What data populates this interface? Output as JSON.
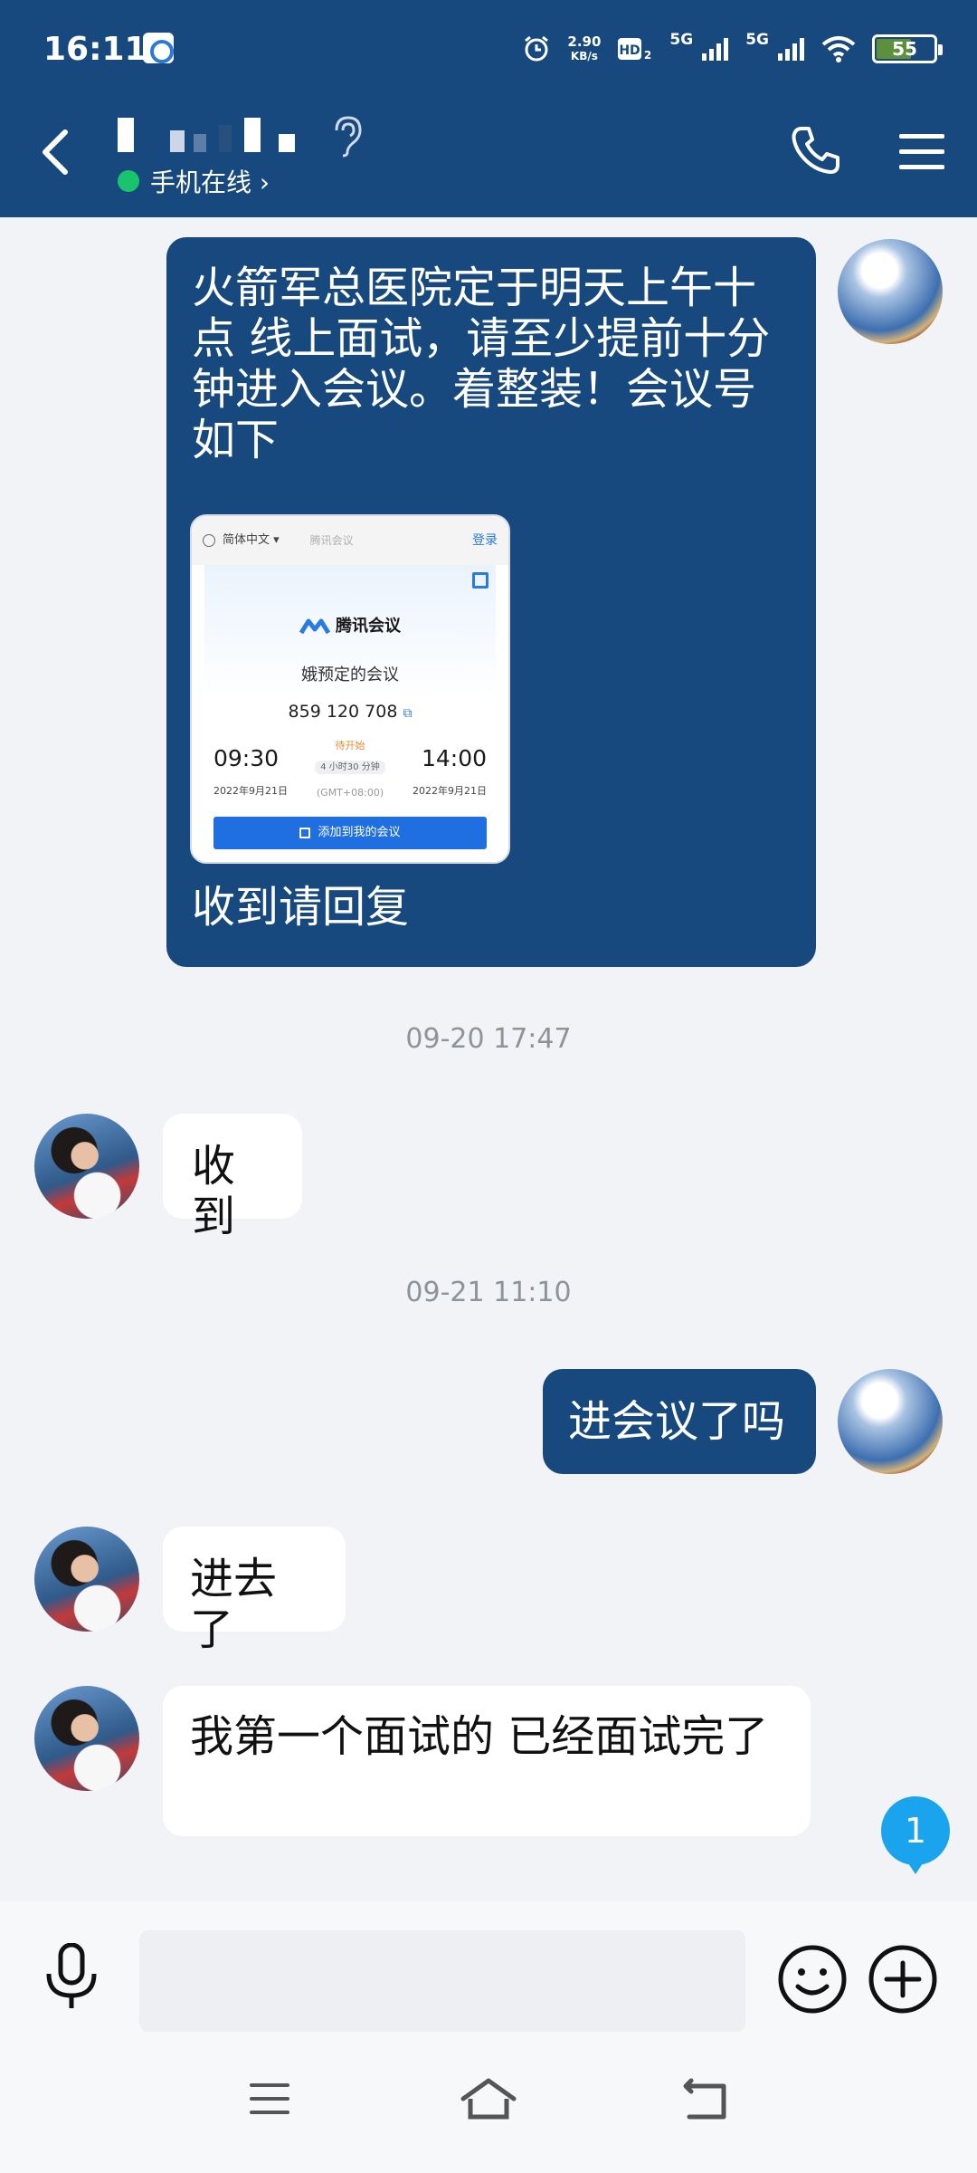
{
  "status_bar": {
    "time": "16:11",
    "net_speed_value": "2.90",
    "net_speed_unit": "KB/s",
    "hd_label": "HD",
    "hd_sub": "2",
    "signal1_label": "5G",
    "signal2_label": "5G",
    "battery_level": "55",
    "battery_color": "#5e8f3c"
  },
  "header": {
    "background": "#17497f",
    "presence_text": "手机在线 ›",
    "presence_color": "#19c46d",
    "icons": [
      "back-arrow-icon",
      "ear-icon",
      "phone-icon",
      "menu-icon"
    ]
  },
  "messages": {
    "m1": {
      "text": "火箭军总医院定于明天上午十点  线上面试，请至少提前十分钟进入会议。着整装！会议号如下",
      "reply": "收到请回复",
      "card": {
        "lang": "简体中文 ▾",
        "mini_logo": "腾讯会议",
        "login": "登录",
        "logo_text": "腾讯会议",
        "meeting_title": "娥预定的会议",
        "meeting_id": "859 120 708",
        "status": "待开始",
        "start_time": "09:30",
        "start_date": "2022年9月21日",
        "end_time": "14:00",
        "end_date": "2022年9月21日",
        "duration": "4 小时30 分钟",
        "timezone": "(GMT+08:00)",
        "add_button": "添加到我的会议"
      }
    },
    "ts1": "09-20 17:47",
    "m2": "收到",
    "ts2": "09-21 11:10",
    "m3": "进会议了吗",
    "m4": "进去了",
    "m5": "我第一个面试的  已经面试完了",
    "unread_count": "1"
  },
  "input_bar": {
    "placeholder": "",
    "icons": [
      "microphone-icon",
      "emoji-icon",
      "plus-icon"
    ]
  },
  "nav_bar": {
    "icons": [
      "nav-menu-icon",
      "nav-home-icon",
      "nav-back-icon"
    ]
  },
  "colors": {
    "outgoing_bubble": "#17497f",
    "incoming_bubble": "#ffffff",
    "chat_background": "#f2f3f7",
    "unread_badge": "#1aa4ee"
  }
}
